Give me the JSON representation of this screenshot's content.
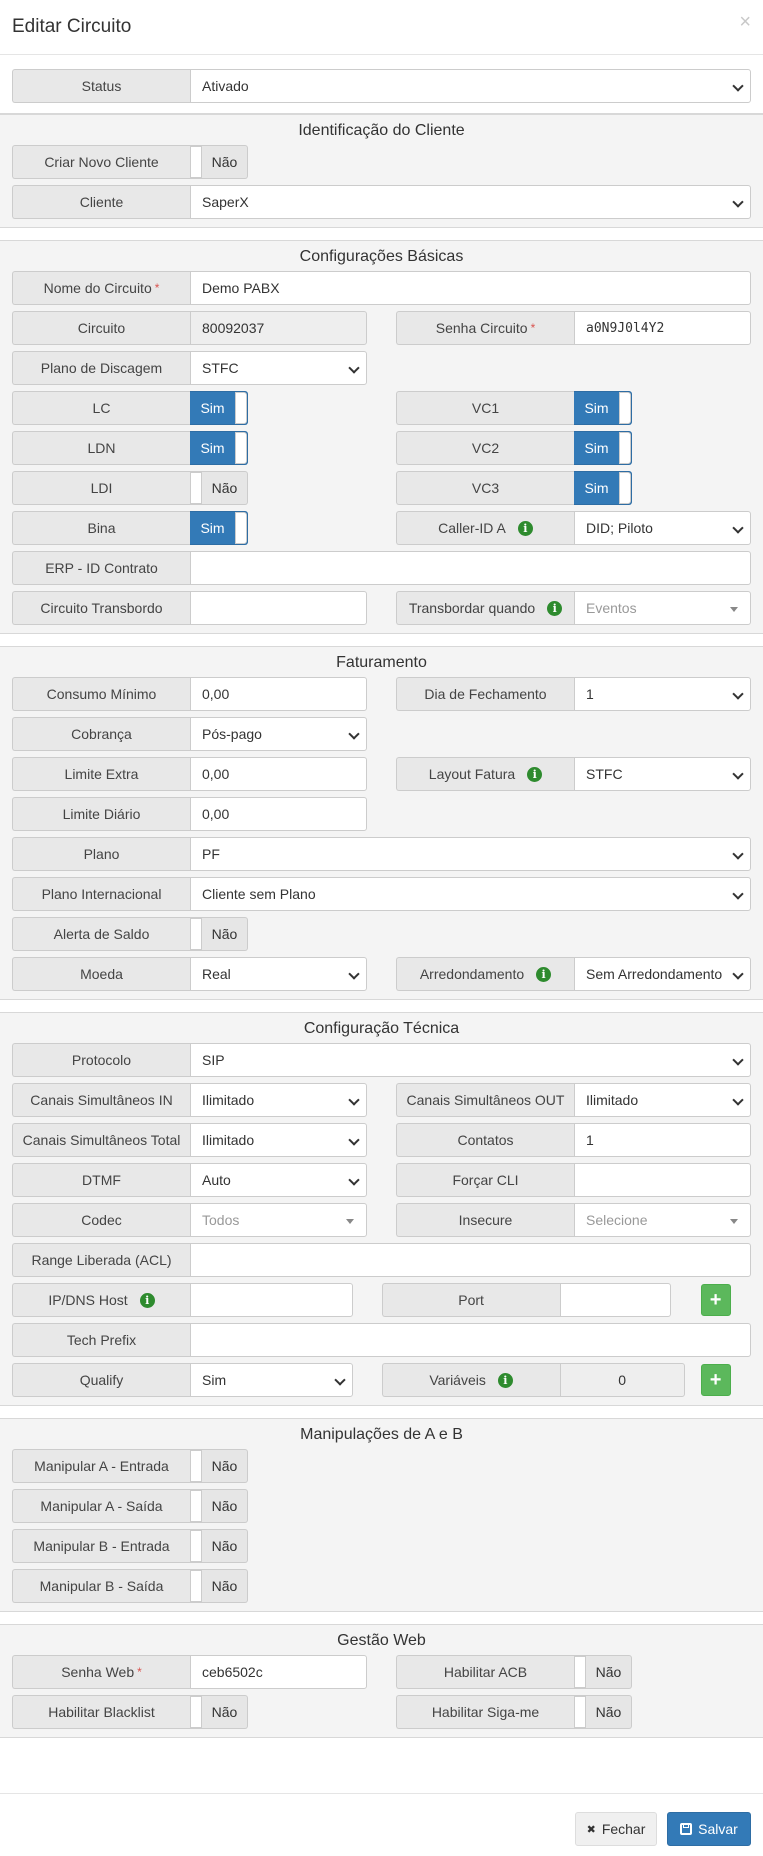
{
  "modal": {
    "title": "Editar Circuito",
    "close": "×"
  },
  "status": {
    "label": "Status",
    "value": "Ativado"
  },
  "cliente": {
    "title": "Identificação do Cliente",
    "novo_label": "Criar Novo Cliente",
    "novo_value": "Não",
    "cliente_label": "Cliente",
    "cliente_value": "SaperX"
  },
  "basic": {
    "title": "Configurações Básicas",
    "nome_label": "Nome do Circuito",
    "nome_value": "Demo PABX",
    "circuito_label": "Circuito",
    "circuito_value": "80092037",
    "senha_label": "Senha Circuito",
    "senha_value": "a0N9J0l4Y2",
    "plano_label": "Plano de Discagem",
    "plano_value": "STFC",
    "lc_label": "LC",
    "lc_value": "Sim",
    "vc1_label": "VC1",
    "vc1_value": "Sim",
    "ldn_label": "LDN",
    "ldn_value": "Sim",
    "vc2_label": "VC2",
    "vc2_value": "Sim",
    "ldi_label": "LDI",
    "ldi_value": "Não",
    "vc3_label": "VC3",
    "vc3_value": "Sim",
    "bina_label": "Bina",
    "bina_value": "Sim",
    "callerid_label": "Caller-ID A",
    "callerid_value": "DID; Piloto",
    "erp_label": "ERP - ID Contrato",
    "erp_value": "",
    "transbordo_label": "Circuito Transbordo",
    "transbordo_value": "",
    "transbordar_label": "Transbordar quando",
    "transbordar_placeholder": "Eventos"
  },
  "billing": {
    "title": "Faturamento",
    "consumo_label": "Consumo Mínimo",
    "consumo_value": "0,00",
    "dia_label": "Dia de Fechamento",
    "dia_value": "1",
    "cobranca_label": "Cobrança",
    "cobranca_value": "Pós-pago",
    "limite_extra_label": "Limite Extra",
    "limite_extra_value": "0,00",
    "layout_label": "Layout Fatura",
    "layout_value": "STFC",
    "limite_diario_label": "Limite Diário",
    "limite_diario_value": "0,00",
    "plano_label": "Plano",
    "plano_value": "PF",
    "plano_int_label": "Plano Internacional",
    "plano_int_value": "Cliente sem Plano",
    "alerta_label": "Alerta de Saldo",
    "alerta_value": "Não",
    "moeda_label": "Moeda",
    "moeda_value": "Real",
    "arred_label": "Arredondamento",
    "arred_value": "Sem Arredondamento"
  },
  "tech": {
    "title": "Configuração Técnica",
    "protocolo_label": "Protocolo",
    "protocolo_value": "SIP",
    "canais_in_label": "Canais Simultâneos IN",
    "canais_in_value": "Ilimitado",
    "canais_out_label": "Canais Simultâneos OUT",
    "canais_out_value": "Ilimitado",
    "canais_total_label": "Canais Simultâneos Total",
    "canais_total_value": "Ilimitado",
    "contatos_label": "Contatos",
    "contatos_value": "1",
    "dtmf_label": "DTMF",
    "dtmf_value": "Auto",
    "forcar_label": "Forçar CLI",
    "forcar_value": "",
    "codec_label": "Codec",
    "codec_placeholder": "Todos",
    "insecure_label": "Insecure",
    "insecure_placeholder": "Selecione",
    "range_label": "Range Liberada (ACL)",
    "range_value": "",
    "ip_label": "IP/DNS Host",
    "ip_value": "",
    "port_label": "Port",
    "port_value": "",
    "prefix_label": "Tech Prefix",
    "prefix_value": "",
    "qualify_label": "Qualify",
    "qualify_value": "Sim",
    "vars_label": "Variáveis",
    "vars_value": "0",
    "plus": "+"
  },
  "manip": {
    "title": "Manipulações de A e B",
    "a_in_label": "Manipular A - Entrada",
    "a_in_value": "Não",
    "a_out_label": "Manipular A - Saída",
    "a_out_value": "Não",
    "b_in_label": "Manipular B - Entrada",
    "b_in_value": "Não",
    "b_out_label": "Manipular B - Saída",
    "b_out_value": "Não"
  },
  "web": {
    "title": "Gestão Web",
    "senha_label": "Senha Web",
    "senha_value": "ceb6502c",
    "acb_label": "Habilitar ACB",
    "acb_value": "Não",
    "blacklist_label": "Habilitar Blacklist",
    "blacklist_value": "Não",
    "sigame_label": "Habilitar Siga-me",
    "sigame_value": "Não"
  },
  "footer": {
    "close_label": "Fechar",
    "save_label": "Salvar"
  },
  "icons": {
    "info": "i",
    "required": "*",
    "close_btn": "✖",
    "save_btn": "💾"
  }
}
